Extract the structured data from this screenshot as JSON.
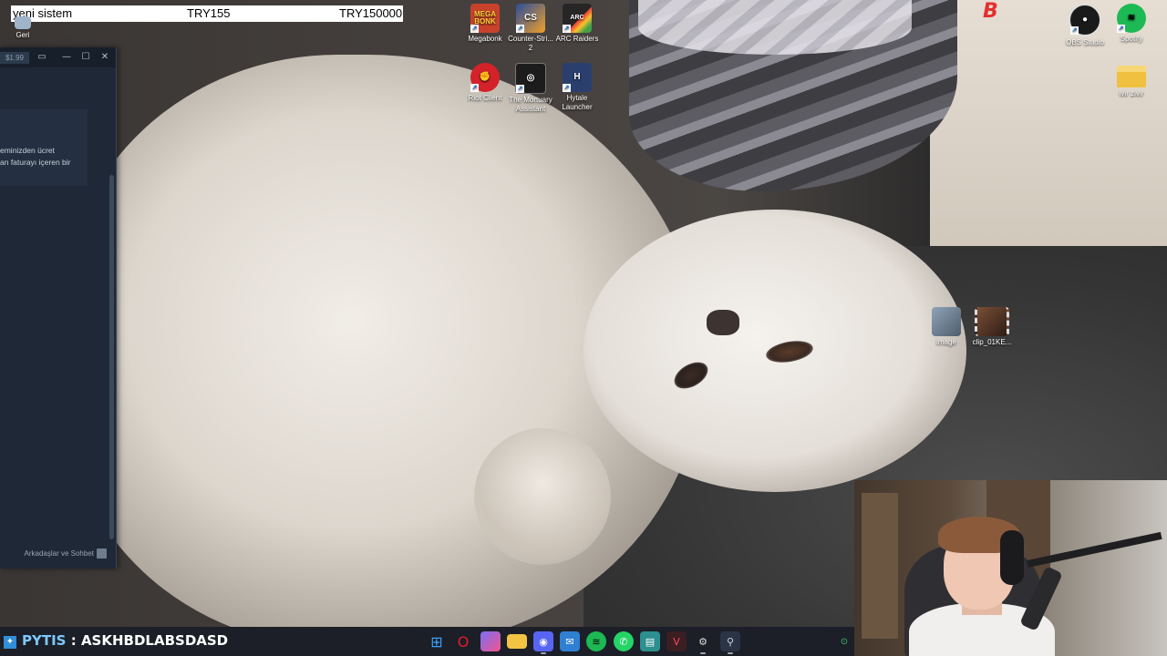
{
  "top_overlay": {
    "label": "yeni sistem",
    "value_1": "TRY155",
    "value_2": "TRY150000"
  },
  "desktop_icons": [
    {
      "name": "megabonk",
      "label": "Megabonk",
      "icon": "megabonk-icon",
      "color": "#c8422b"
    },
    {
      "name": "counter-strike-2",
      "label": "Counter-Stri... 2",
      "icon": "counter-strike-icon",
      "color": "#2a4d9a"
    },
    {
      "name": "arc-raiders",
      "label": "ARC Raiders",
      "icon": "arc-raiders-icon",
      "color": "#262626"
    },
    {
      "name": "riot-client",
      "label": "Riot Client",
      "icon": "riot-client-icon",
      "color": "#d3222a"
    },
    {
      "name": "the-mortuary-assistant",
      "label": "The Mortuary Assistant",
      "icon": "mortuary-assistant-icon",
      "color": "#1c1c1c"
    },
    {
      "name": "hytale-launcher",
      "label": "Hytale Launcher",
      "icon": "hytale-icon",
      "color": "#2b3f6e"
    },
    {
      "name": "obs-studio",
      "label": "OBS Studio",
      "icon": "obs-icon",
      "color": "#1a1a1a"
    },
    {
      "name": "spotify",
      "label": "Spotify",
      "icon": "spotify-icon",
      "color": "#1db954"
    },
    {
      "name": "ivir-zivir",
      "label": "ivir zivir",
      "icon": "folder-icon",
      "color": "#f0c040"
    },
    {
      "name": "image",
      "label": "image",
      "icon": "image-file-icon",
      "color": "#6b7a8c"
    },
    {
      "name": "clip",
      "label": "clip_01KE...",
      "icon": "video-file-icon",
      "color": "#5a3a2a"
    },
    {
      "name": "geri",
      "label": "Geri",
      "icon": "recycle-bin-icon",
      "color": "#9fb4c9"
    }
  ],
  "brand_mark": "B",
  "app_window": {
    "price": "$1.99",
    "message_line_1": "eminizden ücret",
    "message_line_2": "an faturayı içeren bir",
    "footer_label": "Arkadaşlar ve Sohbet"
  },
  "taskbar": {
    "chat_user": "PYTIS",
    "chat_separator": " : ",
    "chat_message": "ASKHBDLABSDASD",
    "apps": [
      {
        "name": "start",
        "icon": "windows-start-icon",
        "color": "#3aa3ff"
      },
      {
        "name": "opera-gx",
        "icon": "opera-icon",
        "color": "#e8192c"
      },
      {
        "name": "copilot",
        "icon": "copilot-icon",
        "color": "#7b6cf6"
      },
      {
        "name": "file-explorer",
        "icon": "folder-icon",
        "color": "#f3c344"
      },
      {
        "name": "discord",
        "icon": "discord-icon",
        "color": "#5865f2"
      },
      {
        "name": "outlook",
        "icon": "outlook-icon",
        "color": "#2f7fd3"
      },
      {
        "name": "spotify",
        "icon": "spotify-icon",
        "color": "#1db954"
      },
      {
        "name": "whatsapp",
        "icon": "whatsapp-icon",
        "color": "#25d366"
      },
      {
        "name": "edge-app",
        "icon": "book-icon",
        "color": "#2d8f8f"
      },
      {
        "name": "valorant",
        "icon": "valorant-icon",
        "color": "#ff4655"
      },
      {
        "name": "riot-client",
        "icon": "riot-client-icon",
        "color": "#d3222a"
      },
      {
        "name": "steam",
        "icon": "steam-icon",
        "color": "#c7d5e0"
      },
      {
        "name": "tray-app",
        "icon": "tray-status-icon",
        "color": "#3ec46d"
      }
    ]
  }
}
